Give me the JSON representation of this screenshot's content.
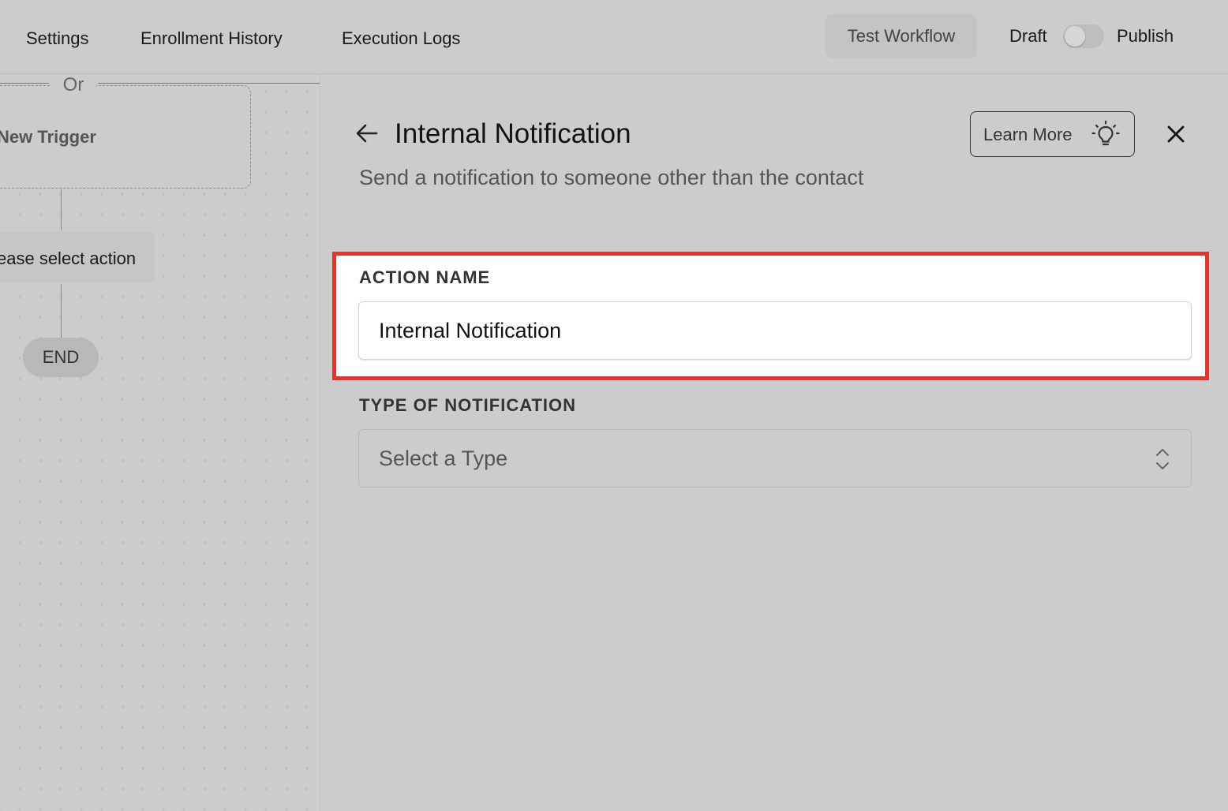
{
  "topbar": {
    "tabs": [
      {
        "label": "Settings"
      },
      {
        "label": "Enrollment History"
      },
      {
        "label": "Execution Logs"
      }
    ],
    "test_button": "Test Workflow",
    "draft_label": "Draft",
    "publish_label": "Publish",
    "publish_toggle_on": false
  },
  "canvas": {
    "or_label": "Or",
    "trigger_label": "New Trigger",
    "action_label": "ease select action",
    "end_label": "END"
  },
  "panel": {
    "title": "Internal Notification",
    "subtitle": "Send a notification to someone other than the contact",
    "learn_more": "Learn More",
    "back_icon": "arrow-left-icon",
    "close_icon": "close-icon",
    "bulb_icon": "lightbulb-icon",
    "highlight_color": "#ff2a1f",
    "action_name": {
      "label": "ACTION NAME",
      "value": "Internal Notification"
    },
    "type_of_notification": {
      "label": "TYPE OF NOTIFICATION",
      "placeholder": "Select a Type"
    }
  }
}
